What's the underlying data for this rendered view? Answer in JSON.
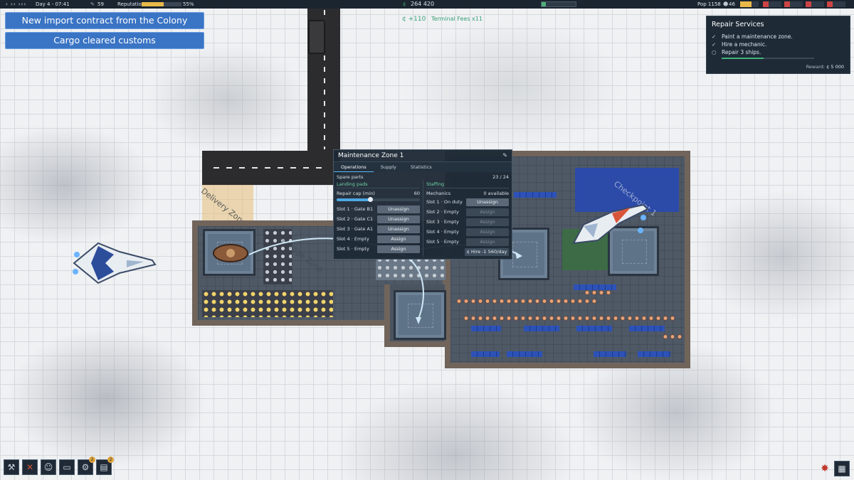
{
  "hud": {
    "controls": "› ›› ›››",
    "day": "Day 4 - 07:41",
    "alerts": "59",
    "reputation_label": "Reputation",
    "reputation_value": "55%",
    "reputation_fraction": 0.55,
    "credits_symbol": "¢",
    "credits": "264 420",
    "population": "Pop 1158",
    "pop_extra": "46"
  },
  "notifications": [
    {
      "text": "New import contract from the Colony"
    },
    {
      "text": "Cargo cleared customs"
    }
  ],
  "floating_text": {
    "amount": "¢ +110",
    "label": "Terminal Fees x11"
  },
  "objective": {
    "title": "Repair Services",
    "tasks": [
      {
        "text": "Paint a maintenance zone.",
        "done": true
      },
      {
        "text": "Hire a mechanic.",
        "done": true
      },
      {
        "text": "Repair 3 ships.",
        "done": false
      }
    ],
    "progress_fraction": 0.45,
    "reward_label": "Reward:",
    "reward_value": "¢ 5 000"
  },
  "map_labels": {
    "delivery": "Delivery Zone 1",
    "storage": "Storage Zone",
    "checkpoint": "Checkpoint 1"
  },
  "maintenance": {
    "title": "Maintenance Zone 1",
    "edit_icon": "pencil-icon",
    "tabs": [
      "Operations",
      "Supply",
      "Statistics"
    ],
    "spare_parts_label": "Spare parts",
    "spare_parts_value": "23 / 24",
    "landing_pads_title": "Landing pads",
    "repair_cap_label": "Repair cap (min)",
    "repair_cap_value": "60",
    "repair_cap_fraction": 0.4,
    "pads": [
      {
        "label": "Slot 1 · Gate B1",
        "action": "Unassign"
      },
      {
        "label": "Slot 2 · Gate C1",
        "action": "Unassign"
      },
      {
        "label": "Slot 3 · Gate A1",
        "action": "Unassign"
      },
      {
        "label": "Slot 4 · Empty",
        "action": "Assign"
      },
      {
        "label": "Slot 5 · Empty",
        "action": "Assign"
      }
    ],
    "staffing_title": "Staffing",
    "mechanics_label": "Mechanics",
    "mechanics_value": "0 available",
    "staff": [
      {
        "label": "Slot 1 · On duty",
        "action": "Unassign"
      },
      {
        "label": "Slot 2 · Empty",
        "action": "Assign"
      },
      {
        "label": "Slot 3 · Empty",
        "action": "Assign"
      },
      {
        "label": "Slot 4 · Empty",
        "action": "Assign"
      },
      {
        "label": "Slot 5 · Empty",
        "action": "Assign"
      }
    ],
    "hire_label": "¢ Hire -1 560/day"
  },
  "toolbar": {
    "badge_1": "2",
    "badge_2": "2"
  }
}
